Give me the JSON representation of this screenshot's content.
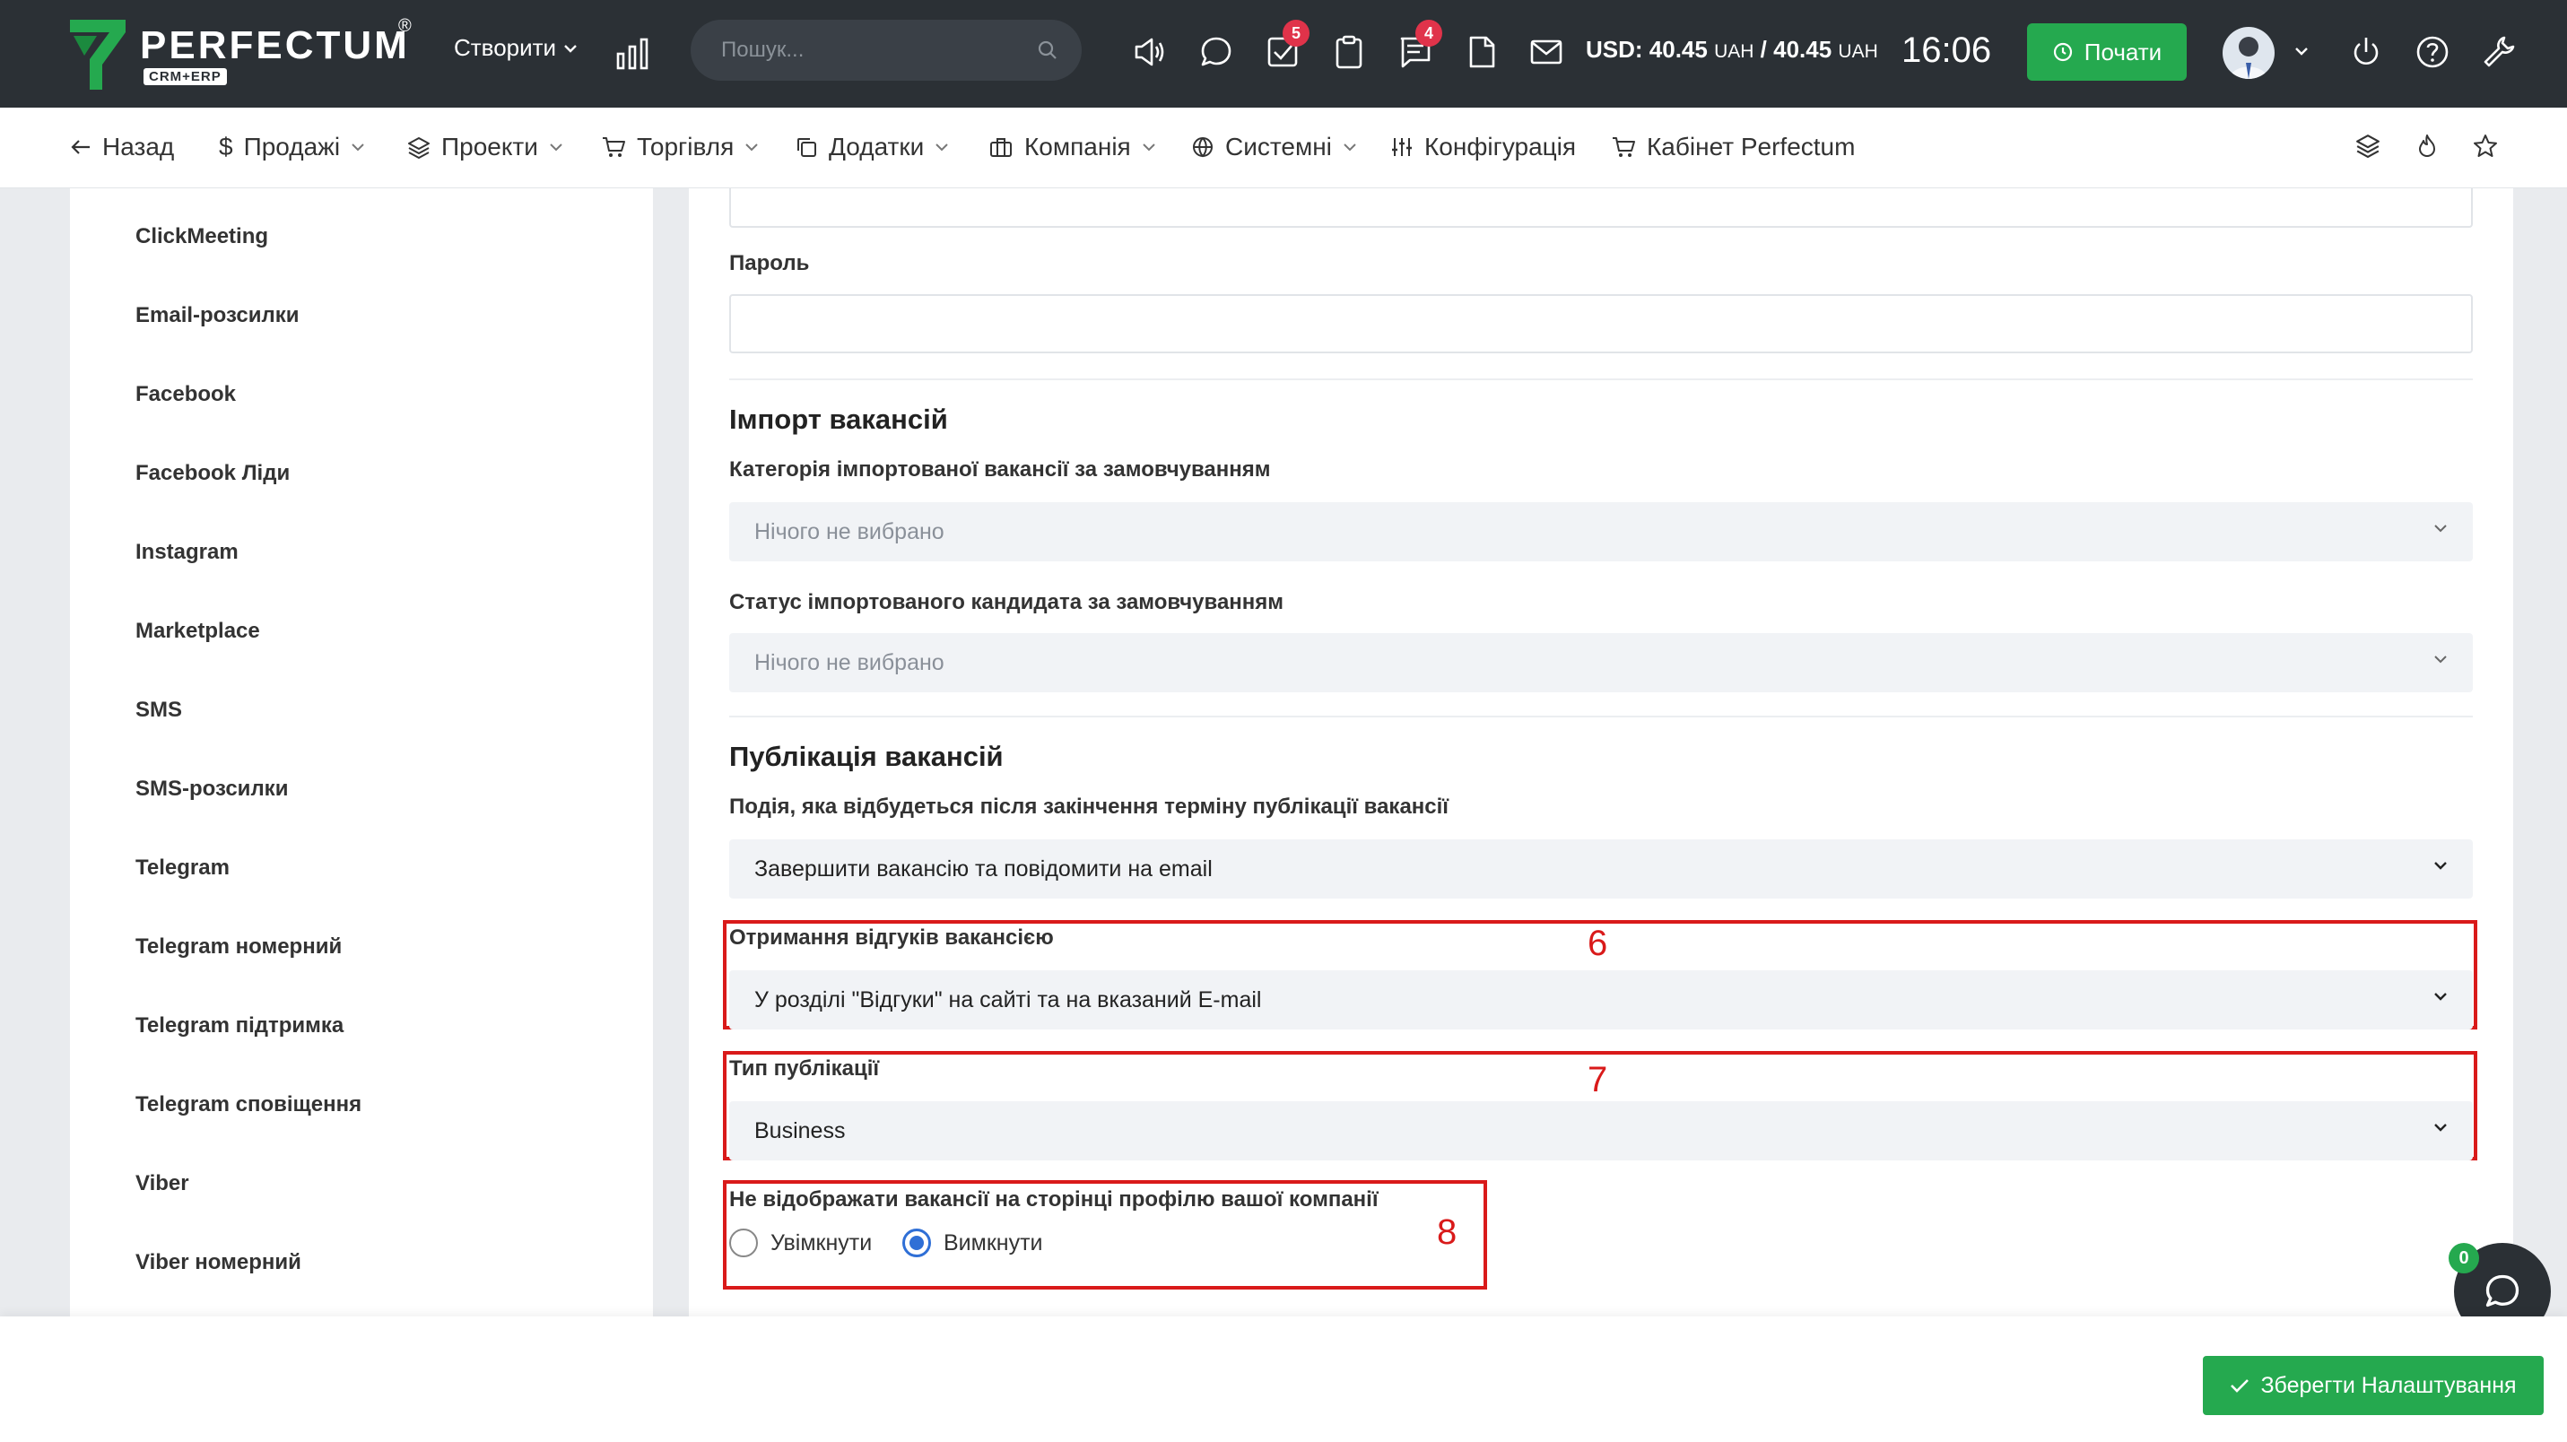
{
  "brand": {
    "name": "PERFECTUM",
    "reg": "®",
    "sub": "CRM+ERP",
    "accent": "#25a94f",
    "dark": "#2b3035"
  },
  "topbar": {
    "create_label": "Створити",
    "search_placeholder": "Пошук...",
    "tasks_badge": "5",
    "notes_badge": "4",
    "currency_usd": "USD: 40.45",
    "currency_unit1": "UAH",
    "currency_sep": "/ 40.45",
    "currency_unit2": "UAH",
    "clock": "16:06",
    "start_label": "Почати"
  },
  "nav": {
    "back": "Назад",
    "sales": "Продажі",
    "projects": "Проекти",
    "trade": "Торгівля",
    "addons": "Додатки",
    "company": "Компанія",
    "system": "Системні",
    "config": "Конфігурація",
    "cabinet": "Кабінет Perfectum"
  },
  "sidebar": {
    "items": [
      "ClickMeeting",
      "Email-розсилки",
      "Facebook",
      "Facebook Ліди",
      "Instagram",
      "Marketplace",
      "SMS",
      "SMS-розсилки",
      "Telegram",
      "Telegram номерний",
      "Telegram підтримка",
      "Telegram сповіщення",
      "Viber",
      "Viber номерний"
    ]
  },
  "form": {
    "password_label": "Пароль",
    "import_title": "Імпорт вакансій",
    "import_category_label": "Категорія імпортованої вакансії за замовчуванням",
    "import_category_value": "Нічого не вибрано",
    "import_status_label": "Статус імпортованого кандидата за замовчуванням",
    "import_status_value": "Нічого не вибрано",
    "publish_title": "Публікація вакансій",
    "expire_event_label": "Подія, яка відбудеться після закінчення терміну публікації вакансії",
    "expire_event_value": "Завершити вакансію та повідомити на email",
    "responses_label": "Отримання відгуків вакансією",
    "responses_value": "У розділі \"Відгуки\" на сайті та на вказаний E-mail",
    "pub_type_label": "Тип публікації",
    "pub_type_value": "Business",
    "hide_label": "Не відображати вакансії на сторінці профілю вашої компанії",
    "radio_on": "Увімкнути",
    "radio_off": "Вимкнути",
    "selected": "off"
  },
  "annotations": {
    "a6": "6",
    "a7": "7",
    "a8": "8",
    "color": "#d91a1a"
  },
  "chat": {
    "badge": "0"
  },
  "footer": {
    "save_label": "Зберегти Налаштування"
  }
}
